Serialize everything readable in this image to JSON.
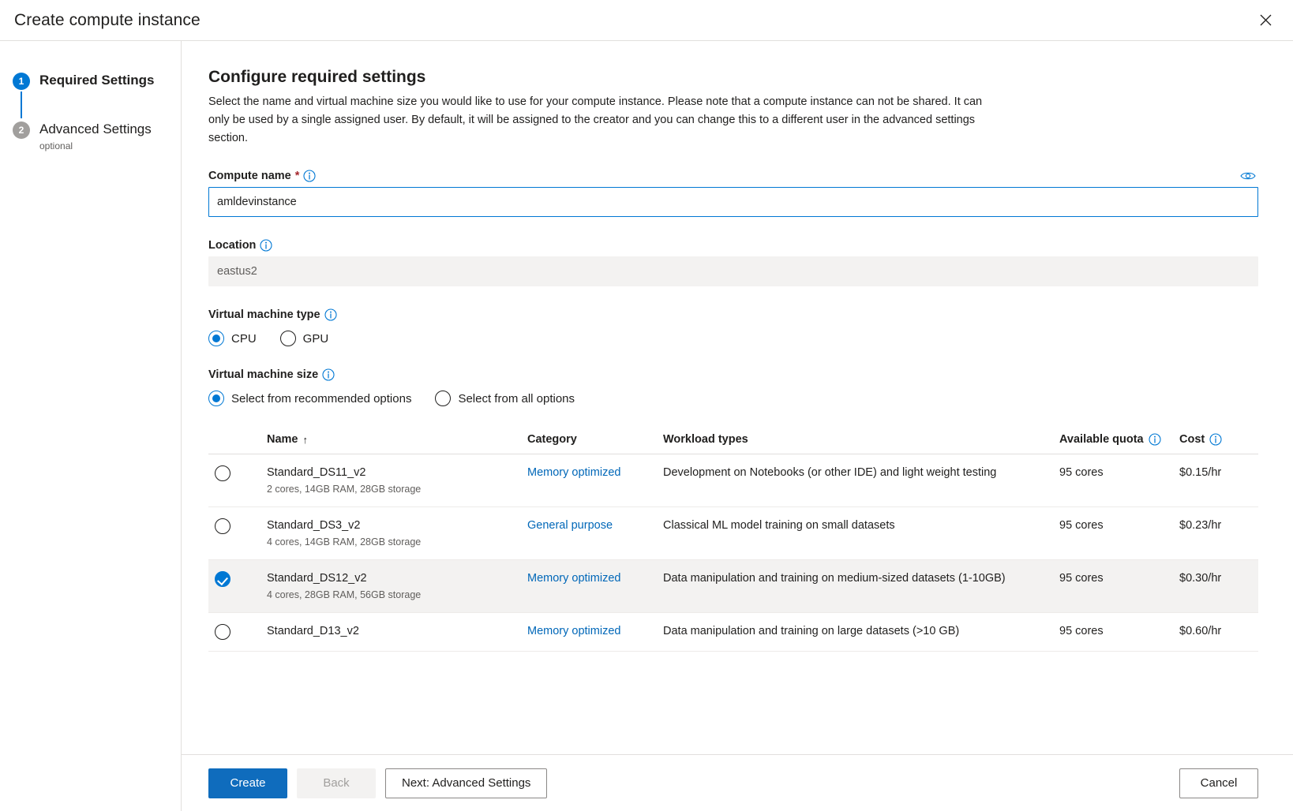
{
  "window": {
    "title": "Create compute instance",
    "close_icon": "close-icon"
  },
  "steps": [
    {
      "number": "1",
      "label": "Required Settings",
      "sub": "",
      "state": "active"
    },
    {
      "number": "2",
      "label": "Advanced Settings",
      "sub": "optional",
      "state": "inactive"
    }
  ],
  "panel": {
    "title": "Configure required settings",
    "description": "Select the name and virtual machine size you would like to use for your compute instance. Please note that a compute instance can not be shared. It can only be used by a single assigned user. By default, it will be assigned to the creator and you can change this to a different user in the advanced settings section."
  },
  "compute_name": {
    "label": "Compute name",
    "required_marker": "*",
    "info_icon": "info-icon",
    "value": "amldevinstance",
    "placeholder": "",
    "reveal_icon": "eye-icon"
  },
  "location": {
    "label": "Location",
    "info_icon": "info-icon",
    "value": "eastus2"
  },
  "vm_type": {
    "label": "Virtual machine type",
    "info_icon": "info-icon",
    "options": [
      {
        "label": "CPU",
        "selected": true
      },
      {
        "label": "GPU",
        "selected": false
      }
    ]
  },
  "vm_size": {
    "label": "Virtual machine size",
    "info_icon": "info-icon",
    "options": [
      {
        "label": "Select from recommended options",
        "selected": true
      },
      {
        "label": "Select from all options",
        "selected": false
      }
    ]
  },
  "table": {
    "columns": {
      "name": "Name",
      "name_sort": "↑",
      "category": "Category",
      "workload": "Workload types",
      "quota": "Available quota",
      "quota_info_icon": "info-icon",
      "cost": "Cost",
      "cost_info_icon": "info-icon"
    },
    "rows": [
      {
        "name": "Standard_DS11_v2",
        "spec": "2 cores, 14GB RAM, 28GB storage",
        "category": "Memory optimized",
        "workload": "Development on Notebooks (or other IDE) and light weight testing",
        "quota": "95 cores",
        "cost": "$0.15/hr",
        "selected": false
      },
      {
        "name": "Standard_DS3_v2",
        "spec": "4 cores, 14GB RAM, 28GB storage",
        "category": "General purpose",
        "workload": "Classical ML model training on small datasets",
        "quota": "95 cores",
        "cost": "$0.23/hr",
        "selected": false
      },
      {
        "name": "Standard_DS12_v2",
        "spec": "4 cores, 28GB RAM, 56GB storage",
        "category": "Memory optimized",
        "workload": "Data manipulation and training on medium-sized datasets (1-10GB)",
        "quota": "95 cores",
        "cost": "$0.30/hr",
        "selected": true
      },
      {
        "name": "Standard_D13_v2",
        "spec": "",
        "category": "Memory optimized",
        "workload": "Data manipulation and training on large datasets (>10 GB)",
        "quota": "95 cores",
        "cost": "$0.60/hr",
        "selected": false
      }
    ]
  },
  "footer": {
    "create": "Create",
    "back": "Back",
    "next": "Next: Advanced Settings",
    "cancel": "Cancel"
  },
  "colors": {
    "accent": "#0078d4",
    "primary_button": "#0f6cbd",
    "link": "#0067b8",
    "required": "#a4262c",
    "selected_row": "#f3f2f1"
  }
}
